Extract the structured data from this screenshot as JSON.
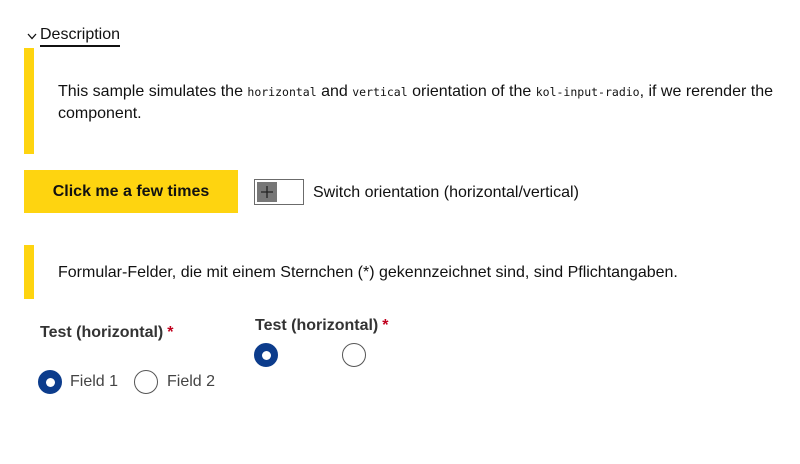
{
  "details": {
    "summary_label": "Description",
    "icon": "chevron-down-icon"
  },
  "description": {
    "text_before": "This sample simulates the ",
    "code_1": "horizontal",
    "text_and": " and ",
    "code_2": "vertical",
    "text_middle": " orientation of the ",
    "code_3": "kol-input-radio",
    "text_after": ", if we rerender the component."
  },
  "controls": {
    "button_label": "Click me a few times",
    "switch_label": "Switch orientation (horizontal/vertical)",
    "switch_icon": "plus-icon",
    "switch_checked": false
  },
  "form_notice": {
    "text": "Formular-Felder, die mit einem Sternchen (*) gekennzeichnet sind, sind Pflichtangaben."
  },
  "radio_groups": [
    {
      "legend": "Test (horizontal)",
      "required_mark": "*",
      "options": [
        {
          "label": "Field 1",
          "checked": true
        },
        {
          "label": "Field 2",
          "checked": false
        }
      ]
    },
    {
      "legend": "Test (horizontal)",
      "required_mark": "*",
      "options": [
        {
          "label": "",
          "checked": true
        },
        {
          "label": "",
          "checked": false
        }
      ]
    }
  ],
  "colors": {
    "accent_yellow": "#fed410",
    "radio_checked": "#0c3c8c",
    "required": "#c0001d"
  }
}
